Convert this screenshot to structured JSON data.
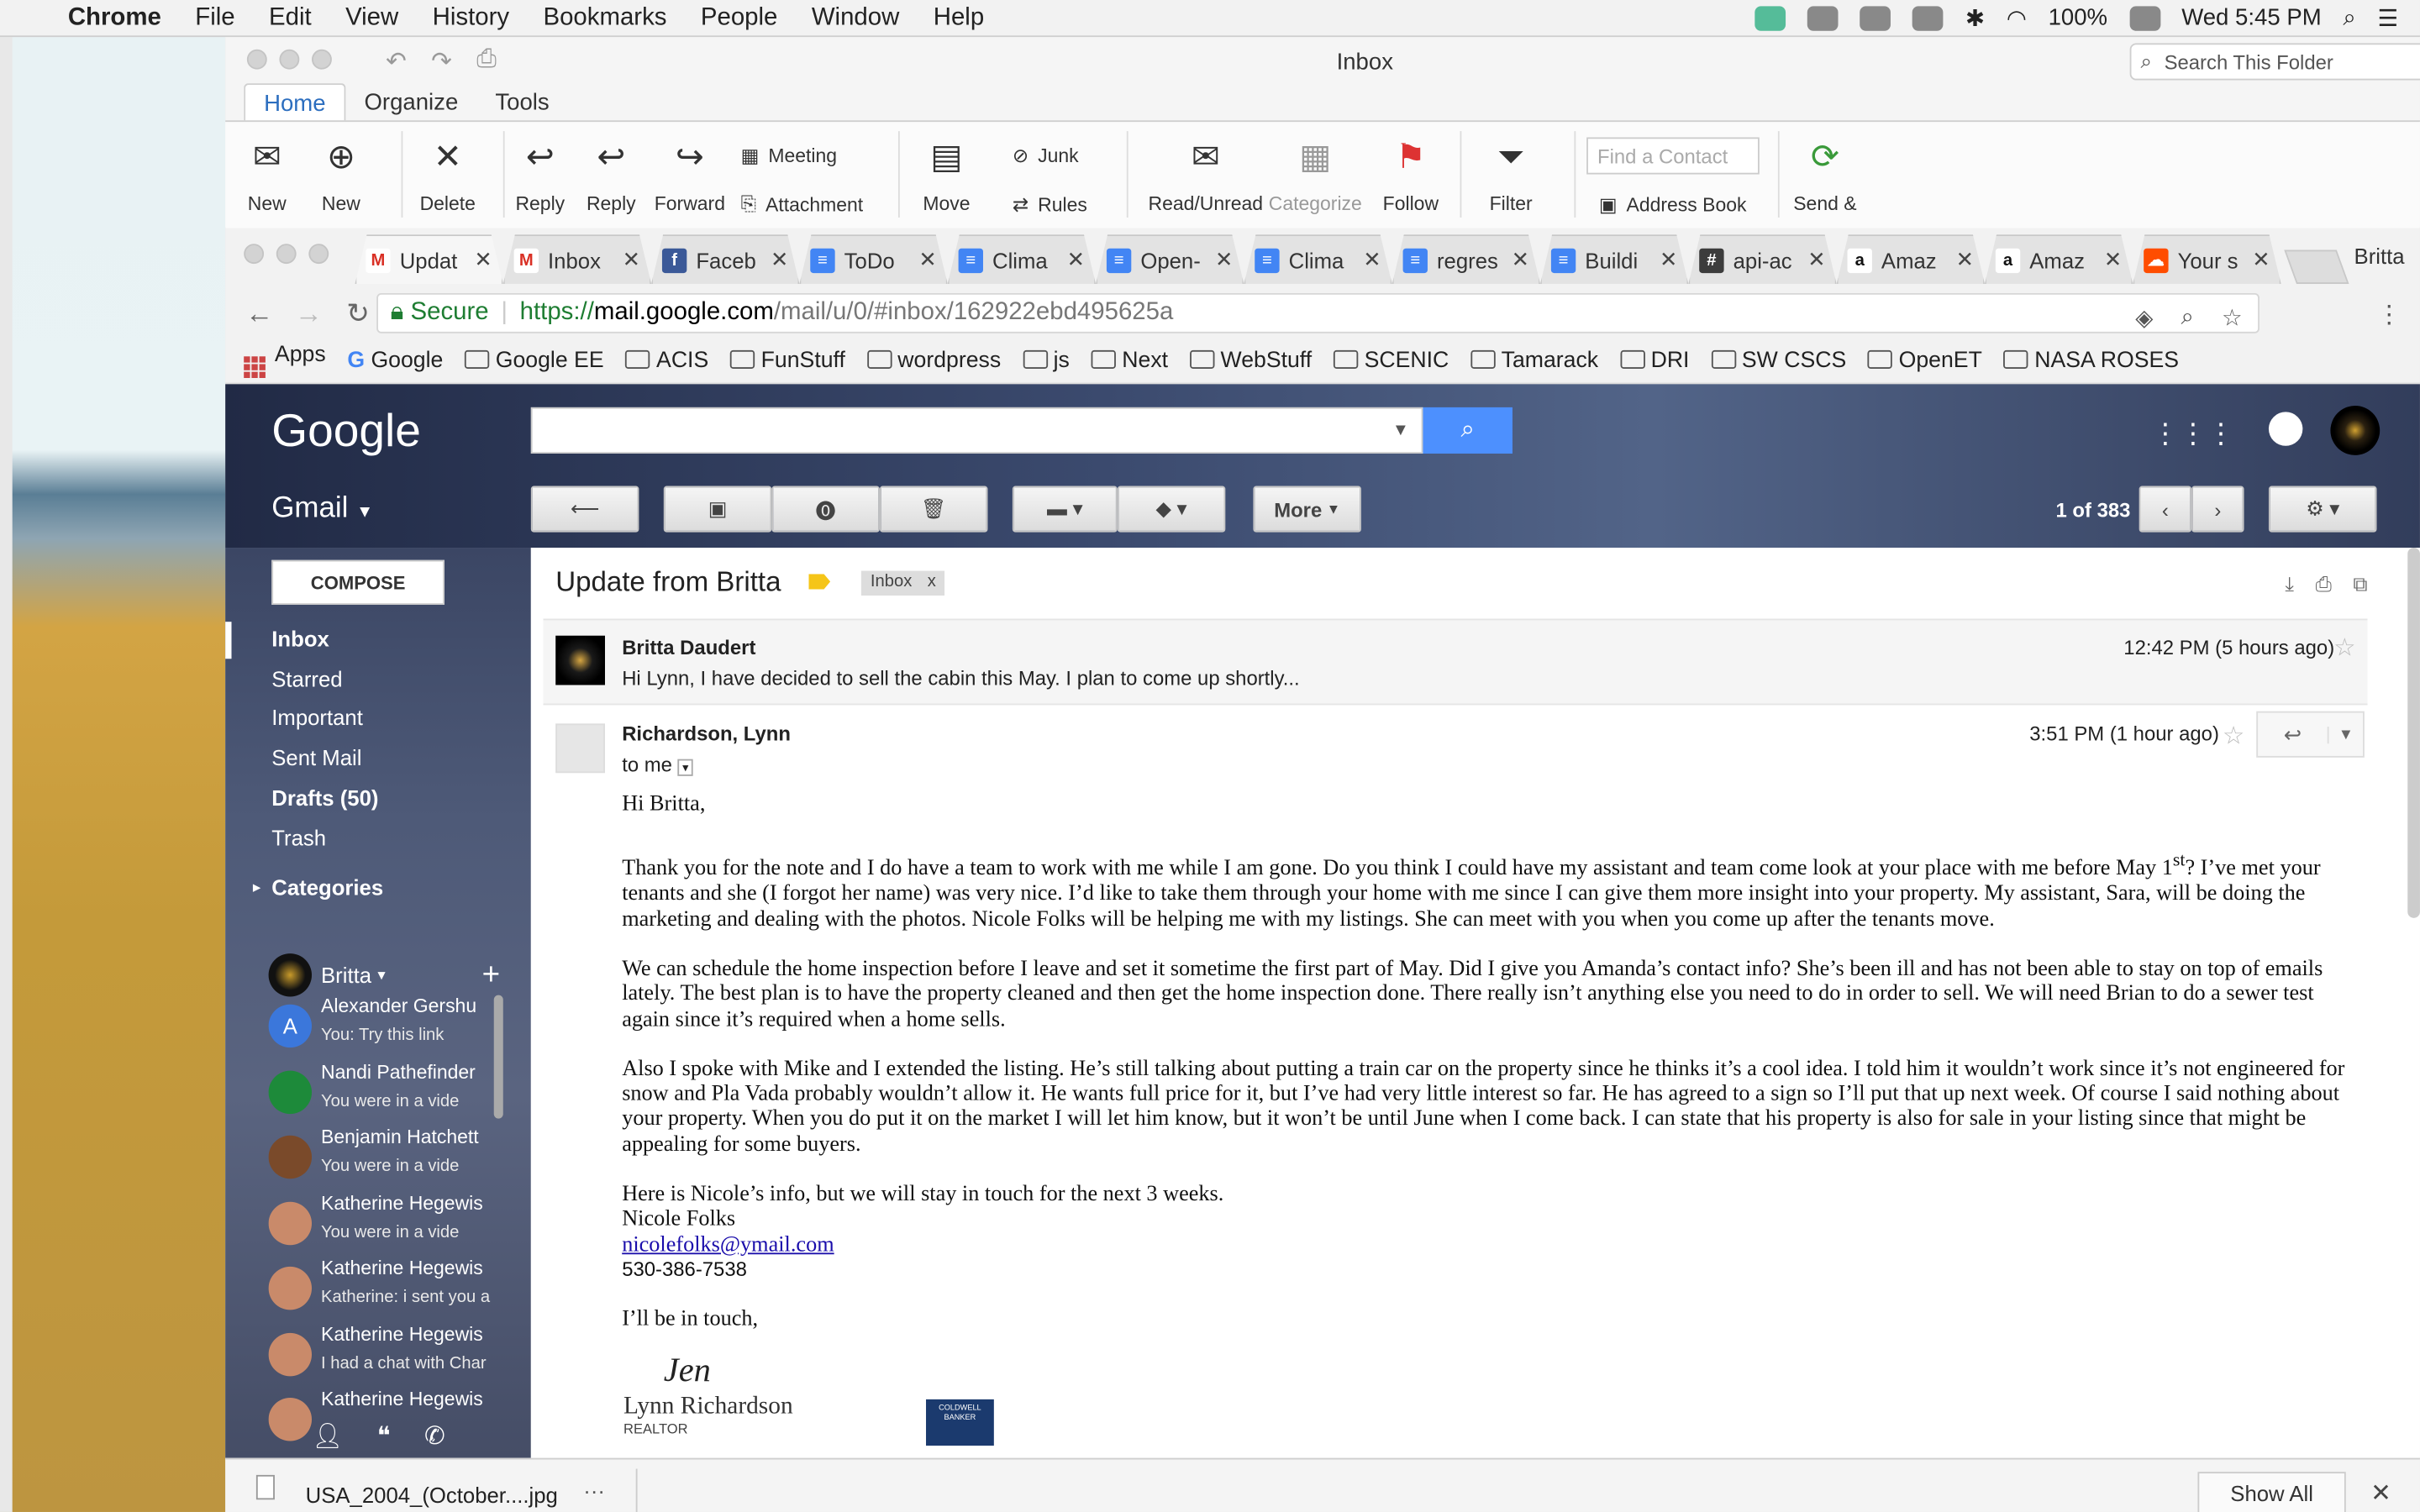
{
  "menubar": {
    "app": "Chrome",
    "items": [
      "File",
      "Edit",
      "View",
      "History",
      "Bookmarks",
      "People",
      "Window",
      "Help"
    ],
    "battery": "100%",
    "clock": "Wed 5:45 PM"
  },
  "outlook": {
    "title": "Inbox",
    "search_placeholder": "Search This Folder",
    "tabs": [
      "Home",
      "Organize",
      "Tools"
    ],
    "ribbon": {
      "new_email": "New",
      "new_items": "New",
      "delete": "Delete",
      "reply": "Reply",
      "reply_all": "Reply",
      "forward": "Forward",
      "meeting": "Meeting",
      "attachment": "Attachment",
      "move": "Move",
      "junk": "Junk",
      "rules": "Rules",
      "read_unread": "Read/Unread",
      "categorize": "Categorize",
      "follow_up": "Follow",
      "filter": "Filter",
      "find_contact": "Find a Contact",
      "address_book": "Address Book",
      "send_receive": "Send &"
    }
  },
  "chrome": {
    "tabs": [
      {
        "title": "Updat",
        "icon": "gmail-icon"
      },
      {
        "title": "Inbox",
        "icon": "gmail-icon"
      },
      {
        "title": "Faceb",
        "icon": "facebook-icon"
      },
      {
        "title": "ToDo",
        "icon": "docs-icon"
      },
      {
        "title": "Clima",
        "icon": "docs-icon"
      },
      {
        "title": "Open-",
        "icon": "docs-icon"
      },
      {
        "title": "Clima",
        "icon": "docs-icon"
      },
      {
        "title": "regres",
        "icon": "docs-icon"
      },
      {
        "title": "Buildi",
        "icon": "docs-icon"
      },
      {
        "title": "api-ac",
        "icon": "slack-icon"
      },
      {
        "title": "Amaz",
        "icon": "amazon-icon"
      },
      {
        "title": "Amaz",
        "icon": "amazon-icon"
      },
      {
        "title": "Your s",
        "icon": "soundcloud-icon"
      }
    ],
    "profile": "Britta",
    "url": {
      "secure": "Secure",
      "scheme": "https://",
      "host": "mail.google.com",
      "path": "/mail/u/0/#inbox/162922ebd495625a"
    },
    "bookmarks": [
      "Apps",
      "Google",
      "Google EE",
      "ACIS",
      "FunStuff",
      "wordpress",
      "js",
      "Next",
      "WebStuff",
      "SCENIC",
      "Tamarack",
      "DRI",
      "SW CSCS",
      "OpenET",
      "NASA ROSES"
    ]
  },
  "gmail": {
    "logo": "Google",
    "label": "Gmail",
    "more": "More",
    "pager": "1 of 383",
    "compose": "COMPOSE",
    "nav": [
      "Inbox",
      "Starred",
      "Important",
      "Sent Mail",
      "Drafts (50)",
      "Trash"
    ],
    "categories": "Categories",
    "hangouts_user": "Britta",
    "chats": [
      {
        "name": "Alexander Gershu",
        "snippet": "You: Try this link",
        "initial": "A",
        "color": "#3b77db"
      },
      {
        "name": "Nandi Pathefinder",
        "snippet": "You were in a vide",
        "initial": "",
        "color": "#1d8a3a"
      },
      {
        "name": "Benjamin Hatchett",
        "snippet": "You were in a vide",
        "initial": "",
        "color": "#7a4a2a"
      },
      {
        "name": "Katherine Hegewis",
        "snippet": "You were in a vide",
        "initial": "",
        "color": "#c98a6a"
      },
      {
        "name": "Katherine Hegewis",
        "snippet": "Katherine: i sent you a",
        "initial": "",
        "color": "#c98a6a"
      },
      {
        "name": "Katherine Hegewis",
        "snippet": "I had a chat with Char",
        "initial": "",
        "color": "#c98a6a"
      },
      {
        "name": "Katherine Hegewis",
        "snippet": "",
        "initial": "",
        "color": "#c98a6a"
      }
    ],
    "thread": {
      "subject": "Update from Britta",
      "label": "Inbox",
      "label_x": "x",
      "msg1": {
        "sender": "Britta Daudert",
        "snippet": "Hi Lynn, I have decided to sell the cabin this May. I plan to come up shortly...",
        "time": "12:42 PM (5 hours ago)"
      },
      "msg2": {
        "sender": "Richardson, Lynn",
        "to": "to me",
        "time": "3:51 PM (1 hour ago)",
        "greeting": "Hi Britta,",
        "p1a": "Thank you for the note and I do have a team to work with me while I am gone.  Do you think I could have my assistant and team come look at your place with me before May 1",
        "p1sup": "st",
        "p1b": "?  I’ve met your tenants and she (I forgot her name) was very nice.  I’d like to take them through your home with me since I can give them more insight into your property.  My assistant, Sara, will be doing the marketing and dealing with the photos.  Nicole Folks will be helping me with my listings.  She can meet with you when you come up after the tenants move.",
        "p2": "We can schedule the home inspection before I leave and set it sometime the first part of May.  Did I give you Amanda’s contact info?  She’s been ill and has not been able to stay on top of emails lately.  The best plan is to have the property cleaned and then get the home inspection done.  There really isn’t anything else you need to do in order to sell.  We will need Brian to do a sewer test again since it’s required when a home sells.",
        "p3": "Also I spoke with Mike and I extended the listing.  He’s still talking about putting a train car on the property since he thinks it’s a cool idea.  I told him it wouldn’t work since it’s not engineered for snow and Pla Vada probably wouldn’t allow it.  He wants full price for it, but I’ve had very little interest so far.  He has agreed to a sign so I’ll put that up next week.  Of course I said nothing about your property.  When you do put it on the market I will let him know, but it won’t be until June when I come back.  I can state that his property is also for sale in your listing since that might be appealing for some buyers.",
        "p4": "Here is Nicole’s info, but we will stay in touch for the next 3 weeks.",
        "contact_name": "Nicole Folks",
        "contact_email": "nicolefolks@ymail.com",
        "contact_phone": "530-386-7538",
        "closing": "I’ll be in touch,",
        "sig_name": "Lynn Richardson",
        "sig_role": "REALTOR",
        "sig_scribble": "Jen",
        "brokerage_logo": "COLDWELL BANKER"
      }
    }
  },
  "downloads": {
    "file": "USA_2004_(October....jpg",
    "more": "···",
    "show_all": "Show All",
    "close": "✕"
  }
}
